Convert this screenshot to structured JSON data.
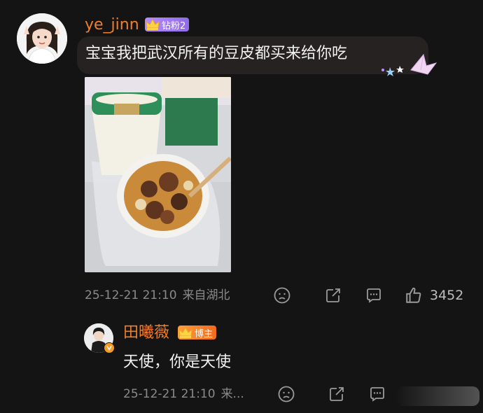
{
  "comments": [
    {
      "username": "ye_jinn",
      "badge": "钻粉2",
      "text": "宝宝我把武汉所有的豆皮都买来给你吃",
      "date": "25-12-21 21:10",
      "location": "来自湖北",
      "likes": "3452"
    },
    {
      "username": "田曦薇",
      "badge": "博主",
      "text": "天使，你是天使",
      "date": "25-12-21 21:10",
      "location": "来..."
    }
  ],
  "colors": {
    "background": "#141414",
    "username": "#f07f2a",
    "fan_badge": "#9b7bf0",
    "host_badge": "#f5822a",
    "meta": "#8a8a8a"
  },
  "icons": [
    "dislike-icon",
    "share-icon",
    "comment-icon",
    "like-icon",
    "verified-icon",
    "paper-crane-icon"
  ]
}
